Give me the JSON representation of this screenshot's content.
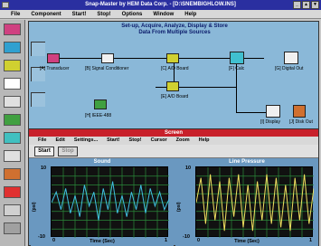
{
  "app": {
    "title": "Snap-Master by HEM Data Corp. - [D:\\SNEMBIGHLOW.INS]",
    "menu": [
      "File",
      "Component",
      "Start!",
      "Stop!",
      "Options",
      "Window",
      "Help"
    ],
    "window_controls": [
      "_",
      "▲",
      "▼"
    ]
  },
  "toolbar": {
    "tools": [
      {
        "icon": "transducer-icon",
        "color": "#d04080"
      },
      {
        "icon": "signal-conditioner-icon",
        "color": "#30a0d0"
      },
      {
        "icon": "analog-board-icon",
        "color": "#d0d030"
      },
      {
        "icon": "digital-wave-icon",
        "color": "#ffffff"
      },
      {
        "icon": "disk-icon",
        "color": "#e0e0e0"
      },
      {
        "icon": "ieee-icon",
        "color": "#40a040"
      },
      {
        "icon": "calc-icon",
        "color": "#40c0c0"
      },
      {
        "icon": "display-icon",
        "color": "#e0e0e0"
      },
      {
        "icon": "disk-out-icon",
        "color": "#d07030"
      },
      {
        "icon": "flag-icon",
        "color": "#e03030"
      },
      {
        "icon": "table-icon",
        "color": "#d0d0d0"
      },
      {
        "icon": "ruler-icon",
        "color": "#a0a0a0"
      }
    ]
  },
  "diagram": {
    "title_line1": "Set-up, Acquire, Analyze, Display & Store",
    "title_line2": "Data From Multiple Sources",
    "blocks": [
      {
        "label": "[A] Transducer",
        "color": "#d04080"
      },
      {
        "label": "[B] Signal Conditioner",
        "color": "#f0f0f0"
      },
      {
        "label": "[C] A/D Board",
        "color": "#d0d030"
      },
      {
        "label": "[F] Calc",
        "color": "#40c0d0"
      },
      {
        "label": "[G] Digital Out",
        "color": "#f0f0f0"
      },
      {
        "label": "[E] A/D Board",
        "color": "#d0d030"
      },
      {
        "label": "[H] IEEE-488",
        "color": "#40a040"
      },
      {
        "label": "[I] Display",
        "color": "#f0f0f0"
      },
      {
        "label": "[J] Disk Out",
        "color": "#d07030"
      }
    ]
  },
  "screen": {
    "title": "Screen",
    "menu": [
      "File",
      "Edit",
      "Settings...",
      "Start!",
      "Stop!",
      "Cursor",
      "Zoom",
      "Help"
    ],
    "start_label": "Start",
    "stop_label": "Stop",
    "charts": [
      {
        "title": "Sound",
        "ylabel": "(psi)",
        "xlabel": "Time (Sec)",
        "ymax": "10",
        "ymin": "-10",
        "xmin": "0",
        "xmax": "1"
      },
      {
        "title": "Line Pressure",
        "ylabel": "(psi)",
        "xlabel": "Time (Sec)",
        "ymax": "10",
        "ymin": "-10",
        "xmin": "0",
        "xmax": "1"
      }
    ]
  },
  "chart_data": [
    {
      "type": "line",
      "title": "Sound",
      "xlabel": "Time (Sec)",
      "ylabel": "(psi)",
      "xlim": [
        0,
        1
      ],
      "ylim": [
        -10,
        10
      ],
      "grid": true,
      "series": [
        {
          "color": "#40c0e0",
          "x": [
            0,
            0.04,
            0.08,
            0.12,
            0.16,
            0.2,
            0.24,
            0.28,
            0.32,
            0.36,
            0.4,
            0.44,
            0.48,
            0.52,
            0.56,
            0.6,
            0.64,
            0.68,
            0.72,
            0.76,
            0.8,
            0.84,
            0.88,
            0.92,
            0.96,
            1
          ],
          "y": [
            0,
            3,
            -2,
            4,
            -3,
            2,
            -4,
            5,
            -1,
            3,
            -5,
            4,
            -2,
            6,
            -3,
            2,
            -4,
            3,
            -2,
            5,
            -3,
            4,
            -1,
            3,
            -2,
            1
          ]
        }
      ]
    },
    {
      "type": "line",
      "title": "Line Pressure",
      "xlabel": "Time (Sec)",
      "ylabel": "(psi)",
      "xlim": [
        0,
        1
      ],
      "ylim": [
        -10,
        10
      ],
      "grid": true,
      "series": [
        {
          "color": "#f0e060",
          "x": [
            0,
            0.04,
            0.08,
            0.12,
            0.16,
            0.2,
            0.24,
            0.28,
            0.32,
            0.36,
            0.4,
            0.44,
            0.48,
            0.52,
            0.56,
            0.6,
            0.64,
            0.68,
            0.72,
            0.76,
            0.8,
            0.84,
            0.88,
            0.92,
            0.96,
            1
          ],
          "y": [
            0,
            7,
            -6,
            8,
            -5,
            6,
            -8,
            7,
            -4,
            8,
            -7,
            5,
            -8,
            6,
            -5,
            8,
            -6,
            7,
            -7,
            5,
            -8,
            7,
            -5,
            8,
            -6,
            4
          ]
        }
      ]
    }
  ]
}
